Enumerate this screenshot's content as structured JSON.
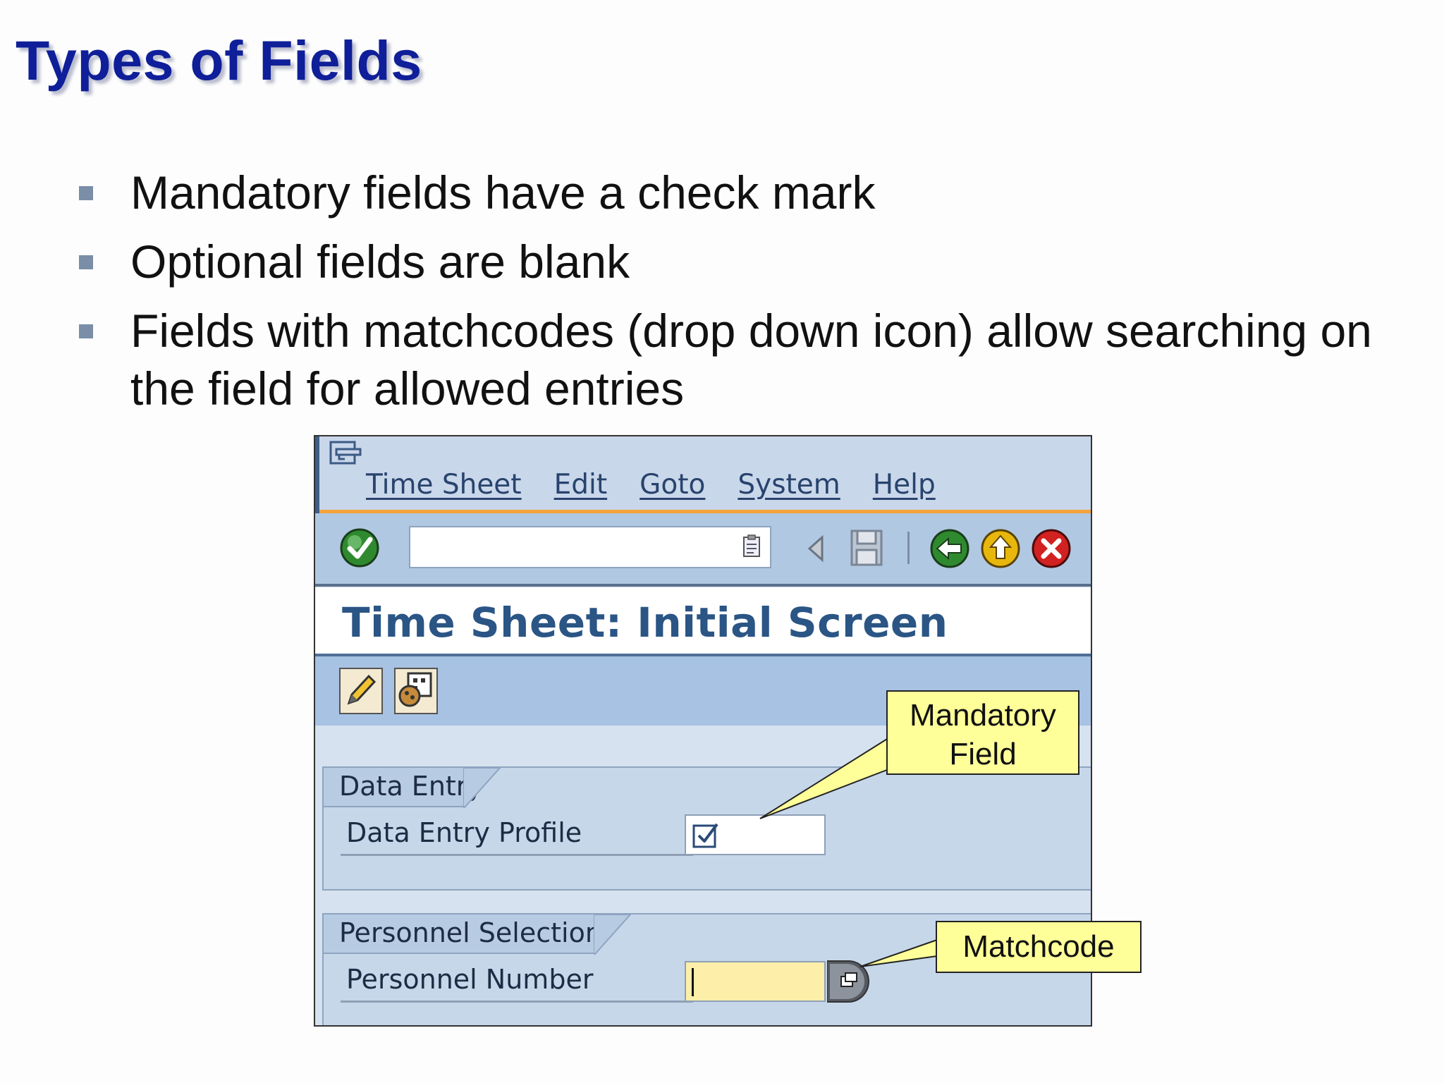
{
  "slide": {
    "title": "Types of Fields",
    "bullets": [
      "Mandatory fields have a check mark",
      "Optional fields are blank",
      "Fields with matchcodes (drop down icon) allow searching on the field for allowed entries"
    ]
  },
  "sap": {
    "menu": [
      "Time Sheet",
      "Edit",
      "Goto",
      "System",
      "Help"
    ],
    "command_field": "",
    "screen_title": "Time Sheet: Initial Screen",
    "groups": [
      {
        "header": "Data Entry",
        "field_label": "Data Entry Profile",
        "field_value": ""
      },
      {
        "header": "Personnel Selection",
        "field_label": "Personnel Number",
        "field_value": ""
      }
    ],
    "icons": {
      "menu": "screen-menu-icon",
      "enter": "green-check-icon",
      "command": "command-history-icon",
      "back_triangle": "triangle-left-icon",
      "save": "save-disk-icon",
      "back": "back-arrow-icon",
      "exit": "exit-up-icon",
      "cancel": "cancel-x-icon",
      "change": "pencil-icon",
      "display": "display-icon",
      "required": "required-check-icon",
      "matchcode": "matchcode-icon"
    },
    "colors": {
      "menu_separator": "#f4a23a",
      "required_field_bg": "#fff",
      "matchcode_field_bg": "#fdeeaa"
    }
  },
  "callouts": {
    "mandatory": "Mandatory Field",
    "matchcode": "Matchcode"
  }
}
